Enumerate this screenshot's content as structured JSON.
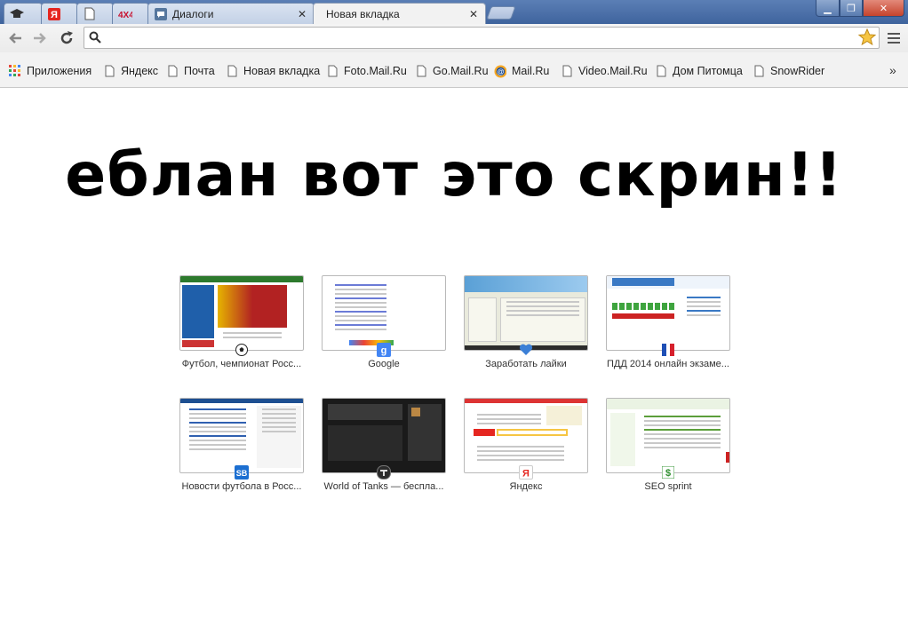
{
  "tabs": [
    {
      "title": "",
      "icon": "graduation-cap-icon",
      "active": false
    },
    {
      "title": "",
      "icon": "yandex-icon",
      "active": false
    },
    {
      "title": "",
      "icon": "page-icon",
      "active": false
    },
    {
      "title": "",
      "icon": "4x4-icon",
      "active": false
    },
    {
      "title": "Диалоги",
      "icon": "chat-icon",
      "active": false
    },
    {
      "title": "Новая вкладка",
      "icon": "",
      "active": true
    }
  ],
  "tab_close_glyph": "✕",
  "window_controls": {
    "minimize": "▁",
    "maximize": "❐",
    "close": "✕"
  },
  "omnibox": {
    "value": "",
    "placeholder": ""
  },
  "bookmarks": [
    {
      "label": "Приложения",
      "icon": "apps-grid-icon"
    },
    {
      "label": "Яндекс",
      "icon": "page-icon"
    },
    {
      "label": "Почта",
      "icon": "page-icon"
    },
    {
      "label": "Новая вкладка",
      "icon": "page-icon"
    },
    {
      "label": "Foto.Mail.Ru",
      "icon": "page-icon"
    },
    {
      "label": "Go.Mail.Ru",
      "icon": "page-icon"
    },
    {
      "label": "Mail.Ru",
      "icon": "mailru-at-icon"
    },
    {
      "label": "Video.Mail.Ru",
      "icon": "page-icon"
    },
    {
      "label": "Дом Питомца",
      "icon": "page-icon"
    },
    {
      "label": "SnowRider",
      "icon": "page-icon"
    }
  ],
  "bookmarks_overflow": "»",
  "overlay_text": "еблан вот это скрин!!",
  "most_visited": [
    {
      "title": "Футбол, чемпионат Росс...",
      "favicon": "soccer-ball-icon"
    },
    {
      "title": "Google",
      "favicon": "google-icon"
    },
    {
      "title": "Заработать лайки",
      "favicon": "heart-icon"
    },
    {
      "title": "ПДД 2014 онлайн экзаме...",
      "favicon": "flag-icon"
    },
    {
      "title": "Новости футбола в Росс...",
      "favicon": "sb-icon"
    },
    {
      "title": "World of Tanks — бесплa...",
      "favicon": "wot-icon"
    },
    {
      "title": "Яндекс",
      "favicon": "yandex-icon"
    },
    {
      "title": "SEO sprint",
      "favicon": "seosprint-icon"
    }
  ],
  "colors": {
    "titlebar": "#4a6ea7",
    "close_button": "#c5432c",
    "google_blue": "#4285f4",
    "yandex_red": "#e52620"
  }
}
